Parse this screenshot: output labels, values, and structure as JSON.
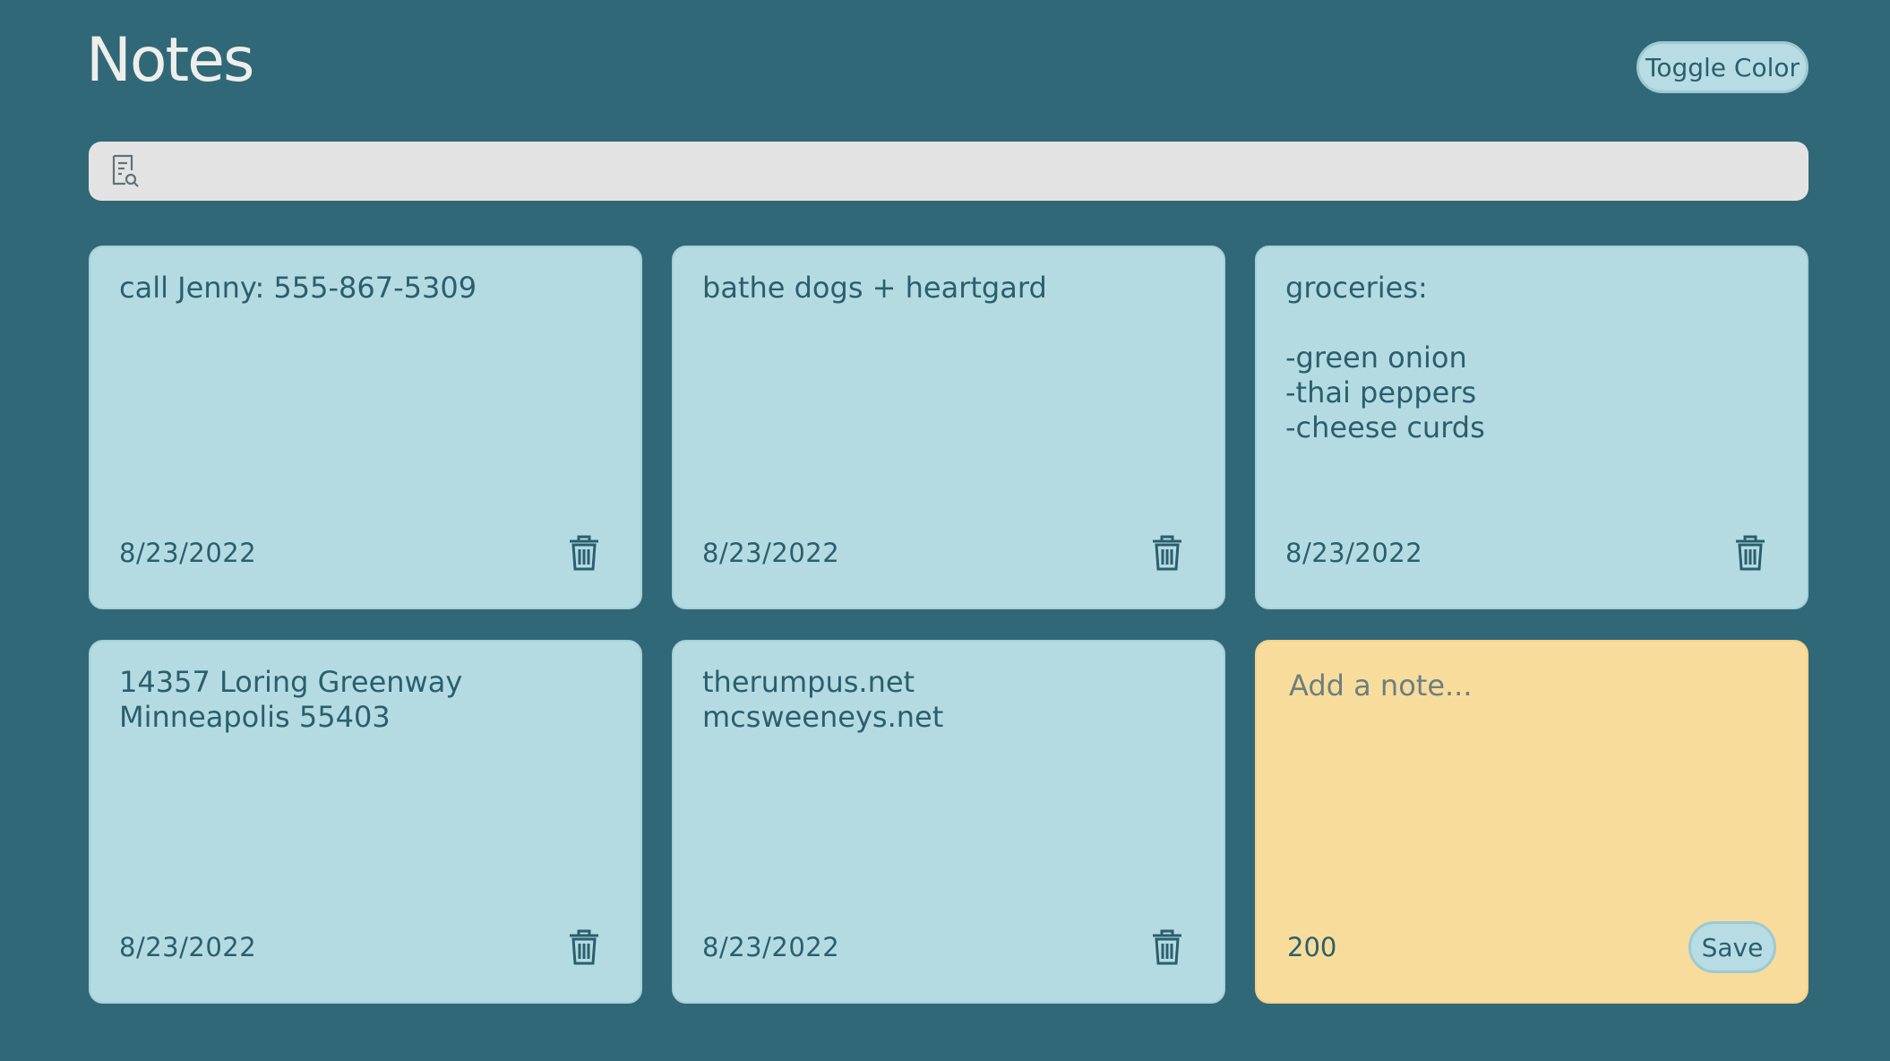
{
  "header": {
    "title": "Notes",
    "toggle_label": "Toggle Color"
  },
  "search": {
    "placeholder": "",
    "value": "",
    "icon": "search-document-icon"
  },
  "notes": [
    {
      "text": "call Jenny: 555-867-5309",
      "date": "8/23/2022"
    },
    {
      "text": "bathe dogs + heartgard",
      "date": "8/23/2022"
    },
    {
      "text": "groceries:\n\n-green onion\n-thai peppers\n-cheese curds",
      "date": "8/23/2022"
    },
    {
      "text": "14357 Loring Greenway\nMinneapolis 55403",
      "date": "8/23/2022"
    },
    {
      "text": "therumpus.net\nmcsweeneys.net",
      "date": "8/23/2022"
    }
  ],
  "new_note": {
    "placeholder": "Add a note...",
    "value": "",
    "remaining": "200",
    "save_label": "Save"
  },
  "colors": {
    "background": "#316877",
    "note": "#b5dbe2",
    "new_note": "#f8dc9c",
    "text": "#2a5f6d"
  }
}
